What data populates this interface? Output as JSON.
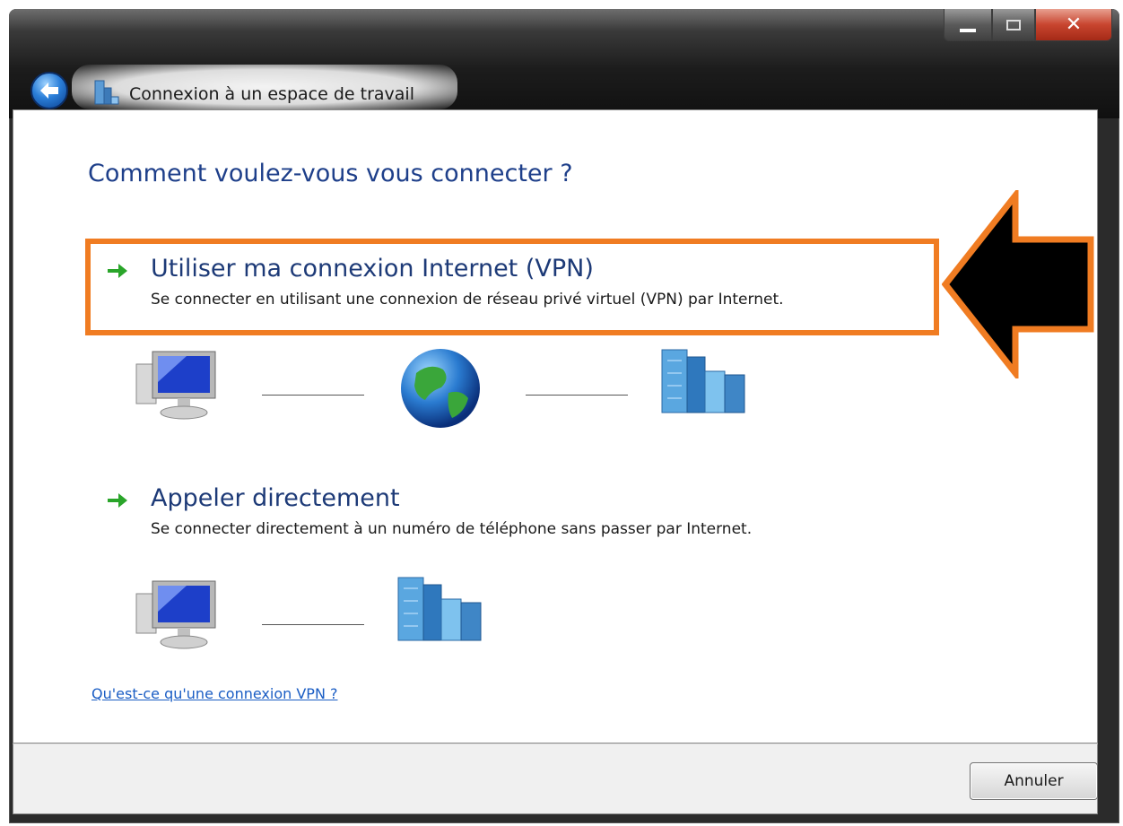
{
  "window": {
    "title": "Connexion à un espace de travail"
  },
  "heading": "Comment voulez-vous vous connecter ?",
  "options": [
    {
      "title": "Utiliser ma connexion Internet (VPN)",
      "description": "Se connecter en utilisant une connexion de réseau privé virtuel (VPN) par Internet.",
      "diagram": [
        "computer-icon",
        "globe-icon",
        "office-building-icon"
      ]
    },
    {
      "title": "Appeler directement",
      "description": "Se connecter directement à un numéro de téléphone sans passer par Internet.",
      "diagram": [
        "computer-icon",
        "office-building-icon"
      ]
    }
  ],
  "help_link": "Qu'est-ce qu'une connexion VPN ?",
  "footer": {
    "cancel_label": "Annuler"
  },
  "colors": {
    "highlight": "#f07c22",
    "heading": "#1e3f8a",
    "link": "#1a5dc4",
    "arrow_green": "#2aa52a"
  }
}
